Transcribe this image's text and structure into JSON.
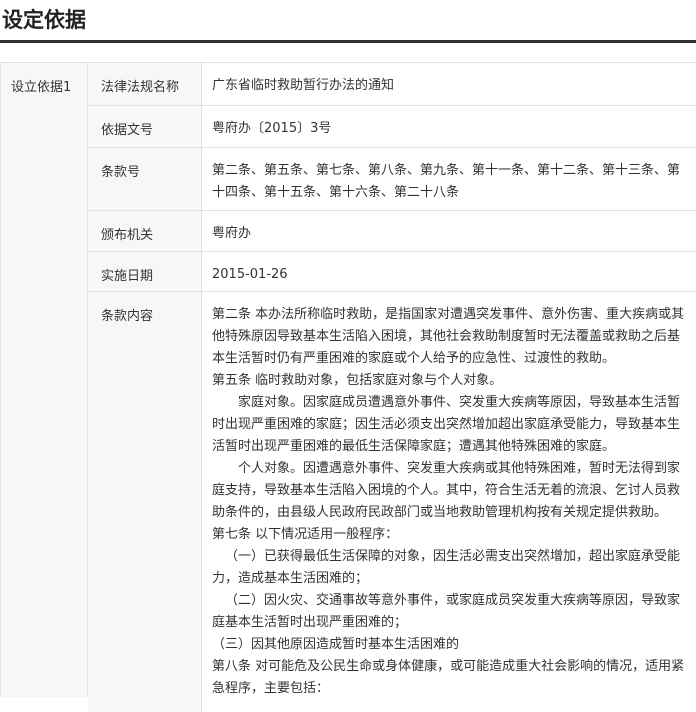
{
  "title": "设定依据",
  "group": {
    "label": "设立依据1"
  },
  "rows": [
    {
      "label": "法律法规名称",
      "value": "广东省临时救助暂行办法的通知"
    },
    {
      "label": "依据文号",
      "value": "粤府办〔2015〕3号"
    },
    {
      "label": "条款号",
      "value": "第二条、第五条、第七条、第八条、第九条、第十一条、第十二条、第十三条、第十四条、第十五条、第十六条、第二十八条"
    },
    {
      "label": "颁布机关",
      "value": "粤府办"
    },
    {
      "label": "实施日期",
      "value": "2015-01-26"
    },
    {
      "label": "条款内容"
    }
  ],
  "content": {
    "paragraphs": [
      "第二条 本办法所称临时救助，是指国家对遭遇突发事件、意外伤害、重大疾病或其他特殊原因导致基本生活陷入困境，其他社会救助制度暂时无法覆盖或救助之后基本生活暂时仍有严重困难的家庭或个人给予的应急性、过渡性的救助。",
      "第五条 临时救助对象，包括家庭对象与个人对象。",
      "家庭对象。因家庭成员遭遇意外事件、突发重大疾病等原因，导致基本生活暂时出现严重困难的家庭；因生活必须支出突然增加超出家庭承受能力，导致基本生活暂时出现严重困难的最低生活保障家庭；遭遇其他特殊困难的家庭。",
      "个人对象。因遭遇意外事件、突发重大疾病或其他特殊困难，暂时无法得到家庭支持，导致基本生活陷入困境的个人。其中，符合生活无着的流浪、乞讨人员救助条件的，由县级人民政府民政部门或当地救助管理机构按有关规定提供救助。",
      "第七条 以下情况适用一般程序：",
      "（一）已获得最低生活保障的对象，因生活必需支出突然增加，超出家庭承受能力，造成基本生活困难的；",
      "（二）因火灾、交通事故等意外事件，或家庭成员突发重大疾病等原因，导致家庭基本生活暂时出现严重困难的；",
      "（三）因其他原因造成暂时基本生活困难的",
      "第八条 对可能危及公民生命或身体健康，或可能造成重大社会影响的情况，适用紧急程序，主要包括："
    ]
  }
}
